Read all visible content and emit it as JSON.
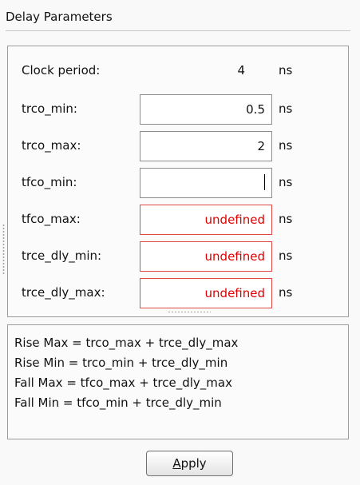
{
  "section_title": "Delay Parameters",
  "clock": {
    "label": "Clock period:",
    "value": "4",
    "unit": "ns"
  },
  "fields": [
    {
      "label": "trco_min:",
      "value": "0.5",
      "unit": "ns"
    },
    {
      "label": "trco_max:",
      "value": "2",
      "unit": "ns"
    },
    {
      "label": "tfco_min:",
      "value": "",
      "unit": "ns"
    },
    {
      "label": "tfco_max:",
      "value": "undefined",
      "unit": "ns"
    },
    {
      "label": "trce_dly_min:",
      "value": "undefined",
      "unit": "ns"
    },
    {
      "label": "trce_dly_max:",
      "value": "undefined",
      "unit": "ns"
    }
  ],
  "formulas": [
    "Rise Max = trco_max + trce_dly_max",
    "Rise Min = trco_min + trce_dly_min",
    "Fall Max = tfco_max + trce_dly_max",
    "Fall Min = tfco_min + trce_dly_min"
  ],
  "apply_button": {
    "mnemonic": "A",
    "rest": "pply"
  },
  "colors": {
    "error_text": "#e00000",
    "error_border": "#e24646"
  }
}
